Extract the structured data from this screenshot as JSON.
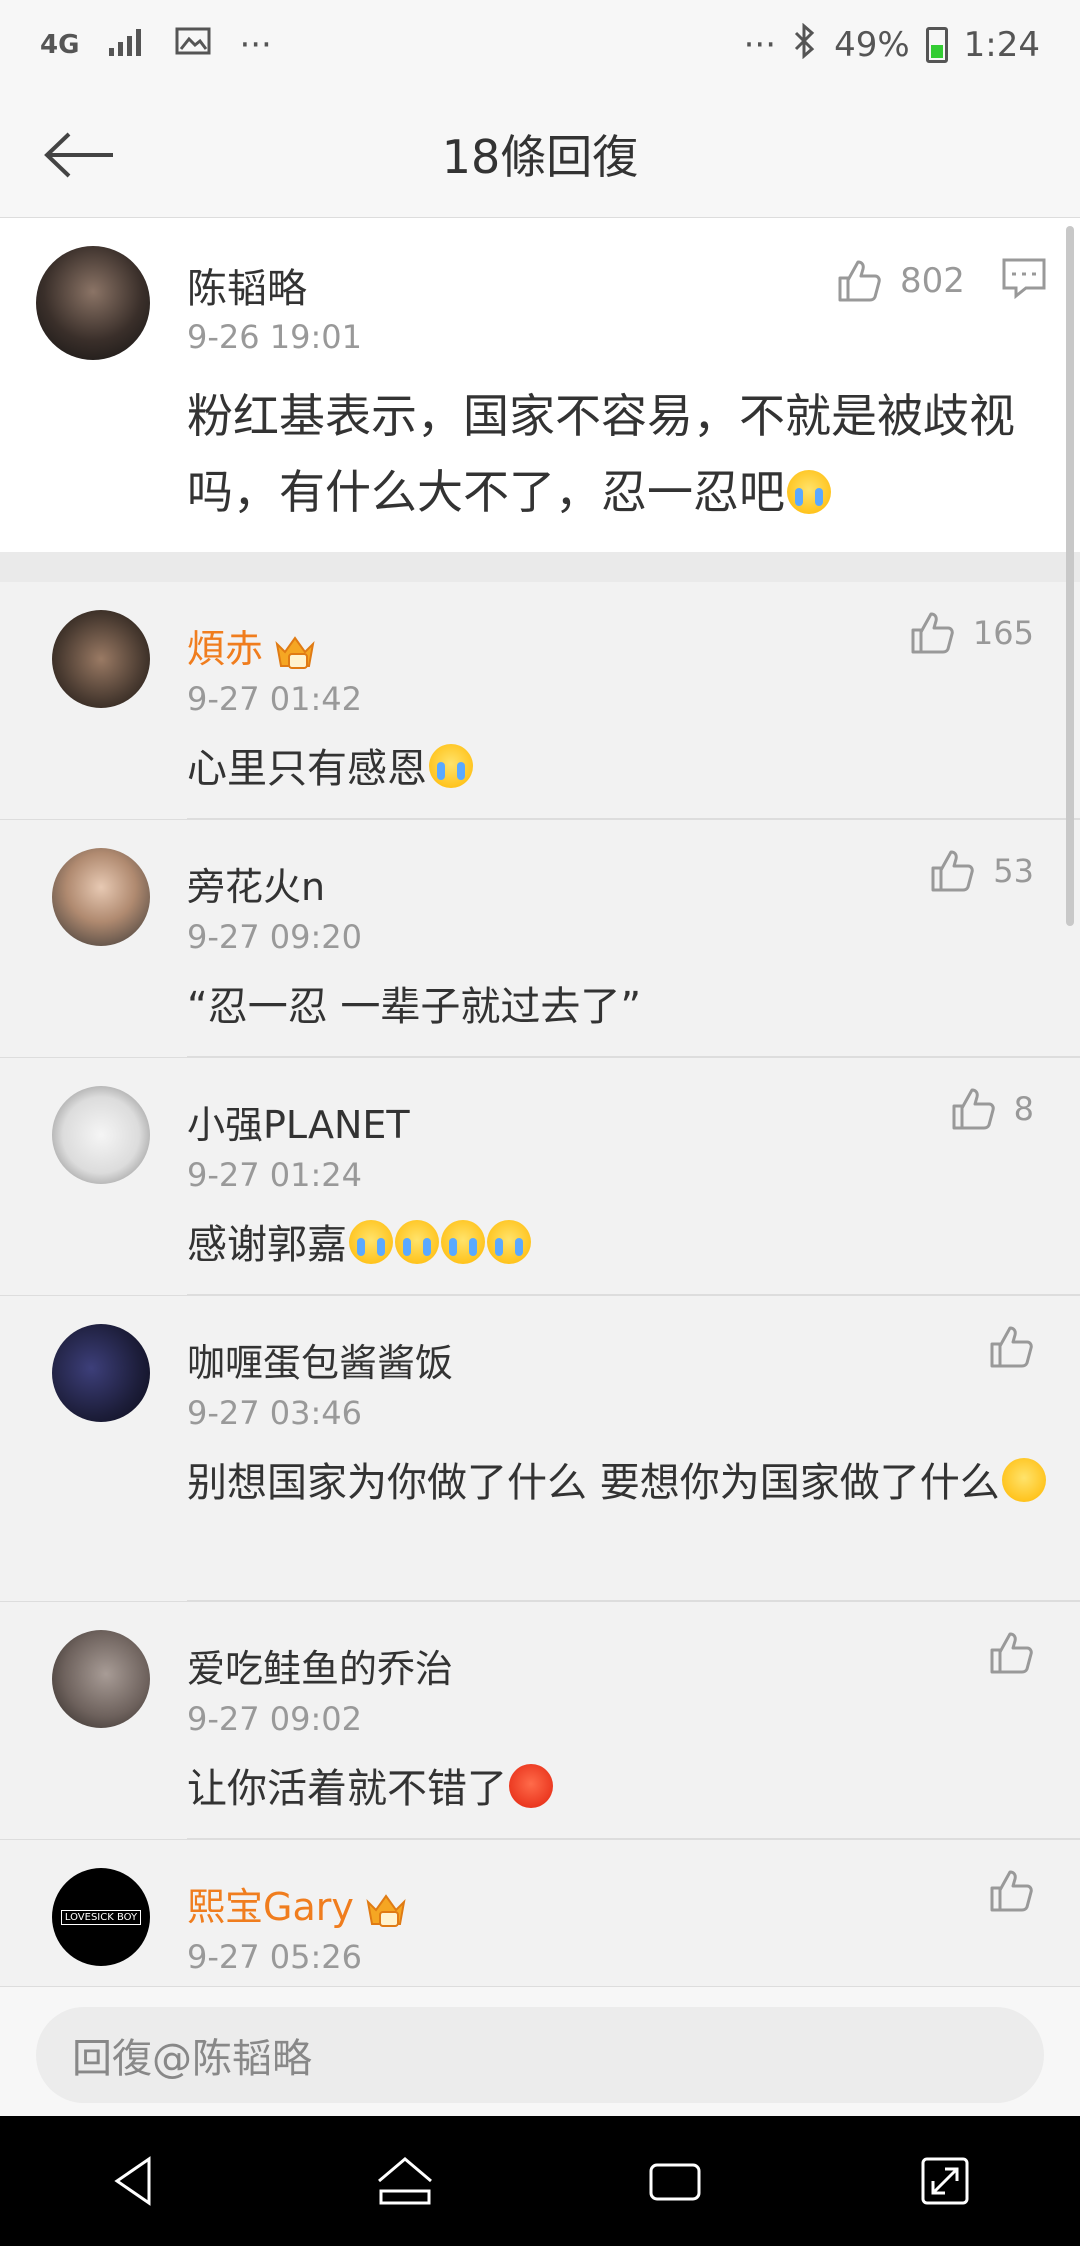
{
  "status_bar": {
    "network": "4G",
    "battery": "49%",
    "time": "1:24",
    "dots": "···"
  },
  "header": {
    "title": "18條回復"
  },
  "root_comment": {
    "username": "陈韬略",
    "time": "9-26 19:01",
    "likes": "802",
    "text": "粉红基表示，国家不容易，不就是被歧视吗，有什么大不了，忍一忍吧"
  },
  "replies": [
    {
      "username": "煩赤",
      "vip": true,
      "time": "9-27 01:42",
      "likes": "165",
      "text": "心里只有感恩"
    },
    {
      "username": "旁花火n",
      "vip": false,
      "time": "9-27 09:20",
      "likes": "53",
      "text": "“忍一忍 一辈子就过去了”"
    },
    {
      "username": "小强PLANET",
      "vip": false,
      "time": "9-27 01:24",
      "likes": "8",
      "text": "感谢郭嘉"
    },
    {
      "username": "咖喱蛋包酱酱饭",
      "vip": false,
      "time": "9-27 03:46",
      "likes": "",
      "text": "别想国家为你做了什么 要想你为国家做了什么"
    },
    {
      "username": "爱吃鲑鱼的乔治",
      "vip": false,
      "time": "9-27 09:02",
      "likes": "",
      "text": "让你活着就不错了"
    },
    {
      "username": "熙宝Gary",
      "vip": true,
      "time": "9-27 05:26",
      "likes": "",
      "text": "",
      "avatar_text": "LOVESICK BOY"
    }
  ],
  "input": {
    "placeholder": "回復@陈韬略"
  }
}
